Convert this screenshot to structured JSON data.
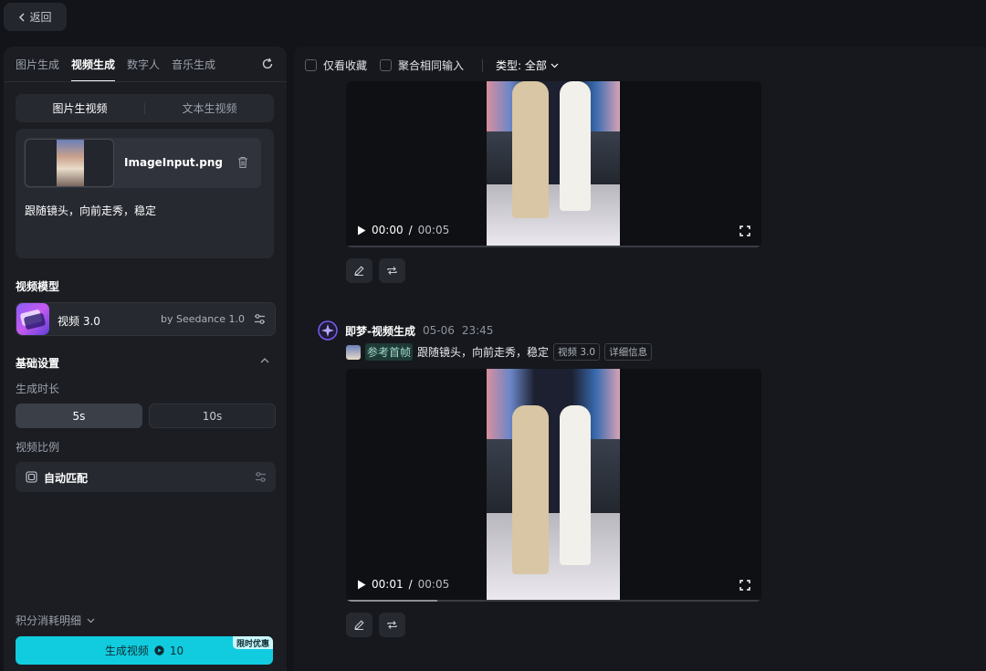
{
  "topbar": {
    "back_label": "返回"
  },
  "left": {
    "tabs": [
      {
        "label": "图片生成",
        "active": false
      },
      {
        "label": "视频生成",
        "active": true
      },
      {
        "label": "数字人",
        "active": false
      },
      {
        "label": "音乐生成",
        "active": false
      }
    ],
    "modes": [
      {
        "label": "图片生视频",
        "active": true
      },
      {
        "label": "文本生视频",
        "active": false
      }
    ],
    "input": {
      "file_name": "ImageInput.png",
      "prompt": "跟随镜头，向前走秀，稳定"
    },
    "model_section_title": "视频模型",
    "model": {
      "name": "视频 3.0",
      "by": "by Seedance 1.0"
    },
    "basic_section_title": "基础设置",
    "duration_label": "生成时长",
    "durations": [
      {
        "label": "5s",
        "active": true
      },
      {
        "label": "10s",
        "active": false
      }
    ],
    "ratio_label": "视频比例",
    "ratio_value": "自动匹配",
    "credits_label": "积分消耗明细",
    "generate": {
      "label": "生成视频",
      "cost": "10",
      "badge": "限时优惠"
    }
  },
  "right": {
    "filters": {
      "favorites_only": "仅看收藏",
      "merge_same_input": "聚合相同输入",
      "type_label": "类型: 全部"
    },
    "videos": [
      {
        "current": "00:00",
        "total": "00:05",
        "progress": 0.0
      },
      {
        "current": "00:01",
        "total": "00:05",
        "progress": 0.22
      }
    ],
    "generation": {
      "author": "即梦-视频生成",
      "date": "05-06",
      "time": "23:45",
      "ref_label": "参考首帧",
      "prompt": "跟随镜头，向前走秀，稳定",
      "model_tag": "视频 3.0",
      "details_tag": "详细信息"
    }
  },
  "colors": {
    "accent": "#11ccdf",
    "badge_bg": "#c9f7fb",
    "panel": "#1b1d23",
    "background": "#121419"
  }
}
